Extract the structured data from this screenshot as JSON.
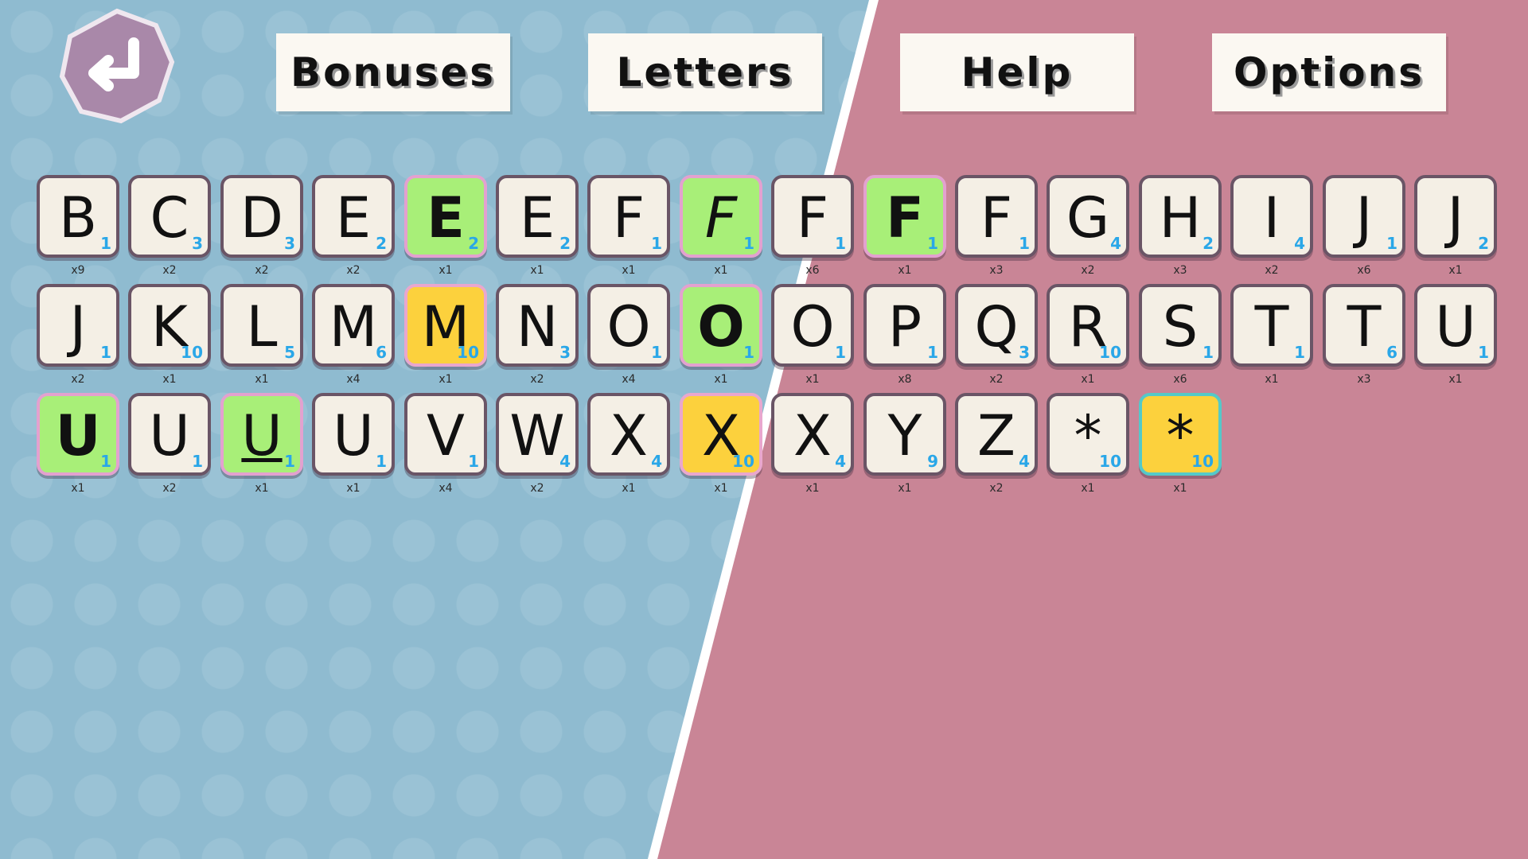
{
  "tabs": [
    {
      "label": "Bonuses"
    },
    {
      "label": "Letters"
    },
    {
      "label": "Help"
    },
    {
      "label": "Options"
    }
  ],
  "colors": {
    "left_bg": "#8fbbd0",
    "right_bg": "#d6a3ae",
    "tile": "#f4efe5",
    "tile_border": "#6a5566",
    "green": "#a8ef78",
    "yellow": "#fcd13d",
    "points": "#2aa7e8",
    "back_button": "#a988a9"
  },
  "back_button": {
    "icon": "return-arrow-icon"
  },
  "rows": [
    [
      {
        "letter": "B",
        "points": "1",
        "count": "x9"
      },
      {
        "letter": "C",
        "points": "3",
        "count": "x2"
      },
      {
        "letter": "D",
        "points": "3",
        "count": "x2"
      },
      {
        "letter": "E",
        "points": "2",
        "count": "x2"
      },
      {
        "letter": "E",
        "points": "2",
        "count": "x1",
        "style": "green",
        "bold": true
      },
      {
        "letter": "E",
        "points": "2",
        "count": "x1"
      },
      {
        "letter": "F",
        "points": "1",
        "count": "x1"
      },
      {
        "letter": "F",
        "points": "1",
        "count": "x1",
        "style": "green",
        "italic": true
      },
      {
        "letter": "F",
        "points": "1",
        "count": "x6"
      },
      {
        "letter": "F",
        "points": "1",
        "count": "x1",
        "style": "green",
        "bold": true
      },
      {
        "letter": "F",
        "points": "1",
        "count": "x3"
      },
      {
        "letter": "G",
        "points": "4",
        "count": "x2"
      },
      {
        "letter": "H",
        "points": "2",
        "count": "x3"
      },
      {
        "letter": "I",
        "points": "4",
        "count": "x2"
      },
      {
        "letter": "J",
        "points": "1",
        "count": "x6"
      },
      {
        "letter": "J",
        "points": "2",
        "count": "x1"
      }
    ],
    [
      {
        "letter": "J",
        "points": "1",
        "count": "x2"
      },
      {
        "letter": "K",
        "points": "10",
        "count": "x1"
      },
      {
        "letter": "L",
        "points": "5",
        "count": "x1"
      },
      {
        "letter": "M",
        "points": "6",
        "count": "x4"
      },
      {
        "letter": "M",
        "points": "10",
        "count": "x1",
        "style": "yellow"
      },
      {
        "letter": "N",
        "points": "3",
        "count": "x2"
      },
      {
        "letter": "O",
        "points": "1",
        "count": "x4"
      },
      {
        "letter": "O",
        "points": "1",
        "count": "x1",
        "style": "green",
        "bold": true
      },
      {
        "letter": "O",
        "points": "1",
        "count": "x1"
      },
      {
        "letter": "P",
        "points": "1",
        "count": "x8"
      },
      {
        "letter": "Q",
        "points": "3",
        "count": "x2"
      },
      {
        "letter": "R",
        "points": "10",
        "count": "x1"
      },
      {
        "letter": "S",
        "points": "1",
        "count": "x6"
      },
      {
        "letter": "T",
        "points": "1",
        "count": "x1"
      },
      {
        "letter": "T",
        "points": "6",
        "count": "x3"
      },
      {
        "letter": "U",
        "points": "1",
        "count": "x1"
      }
    ],
    [
      {
        "letter": "U",
        "points": "1",
        "count": "x1",
        "style": "green",
        "bold": true
      },
      {
        "letter": "U",
        "points": "1",
        "count": "x2"
      },
      {
        "letter": "U",
        "points": "1",
        "count": "x1",
        "style": "green",
        "underline": true
      },
      {
        "letter": "U",
        "points": "1",
        "count": "x1"
      },
      {
        "letter": "V",
        "points": "1",
        "count": "x4"
      },
      {
        "letter": "W",
        "points": "4",
        "count": "x2"
      },
      {
        "letter": "X",
        "points": "4",
        "count": "x1"
      },
      {
        "letter": "X",
        "points": "10",
        "count": "x1",
        "style": "yellow"
      },
      {
        "letter": "X",
        "points": "4",
        "count": "x1"
      },
      {
        "letter": "Y",
        "points": "9",
        "count": "x1"
      },
      {
        "letter": "Z",
        "points": "4",
        "count": "x2"
      },
      {
        "letter": "*",
        "points": "10",
        "count": "x1"
      },
      {
        "letter": "*",
        "points": "10",
        "count": "x1",
        "style": "yellow",
        "teal": true
      }
    ]
  ]
}
